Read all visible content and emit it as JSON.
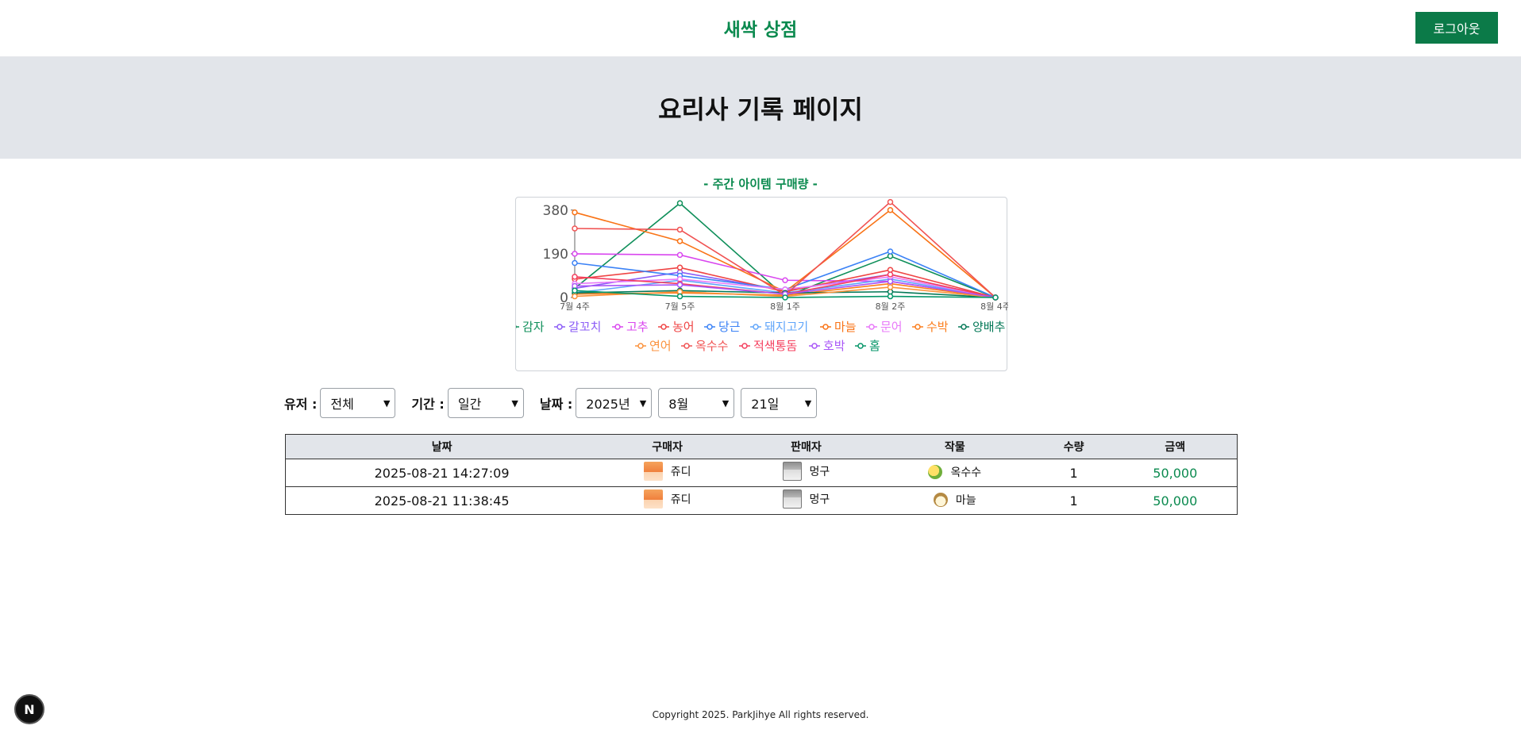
{
  "header": {
    "brand": "새싹 상점",
    "logout_label": "로그아웃"
  },
  "banner": {
    "title": "요리사 기록 페이지"
  },
  "chart": {
    "heading": "- 주간 아이템 구매량 -"
  },
  "chart_data": {
    "type": "line",
    "title": "- 주간 아이템 구매량 -",
    "xlabel": "",
    "ylabel": "",
    "categories": [
      "7월 4주",
      "7월 5주",
      "8월 1주",
      "8월 2주",
      "8월 4주"
    ],
    "yticks": [
      0,
      190,
      380
    ],
    "ylim": [
      0,
      400
    ],
    "legend_position": "bottom",
    "series": [
      {
        "name": "감자",
        "color": "#0f8f5a",
        "values": [
          40,
          410,
          5,
          180,
          0
        ]
      },
      {
        "name": "갈꼬치",
        "color": "#8b5cf6",
        "values": [
          40,
          110,
          30,
          100,
          0
        ]
      },
      {
        "name": "고추",
        "color": "#d946ef",
        "values": [
          190,
          185,
          75,
          70,
          0
        ]
      },
      {
        "name": "농어",
        "color": "#ef4444",
        "values": [
          80,
          130,
          25,
          120,
          0
        ]
      },
      {
        "name": "당근",
        "color": "#3b82f6",
        "values": [
          150,
          95,
          35,
          200,
          0
        ]
      },
      {
        "name": "돼지고기",
        "color": "#60a5fa",
        "values": [
          20,
          75,
          20,
          80,
          0
        ]
      },
      {
        "name": "마늘",
        "color": "#f97316",
        "values": [
          370,
          245,
          25,
          380,
          0
        ]
      },
      {
        "name": "문어",
        "color": "#e879f9",
        "values": [
          60,
          80,
          35,
          90,
          0
        ]
      },
      {
        "name": "수박",
        "color": "#fb7d1c",
        "values": [
          15,
          20,
          10,
          60,
          0
        ]
      },
      {
        "name": "양배추",
        "color": "#047857",
        "values": [
          20,
          30,
          20,
          25,
          0
        ]
      },
      {
        "name": "연어",
        "color": "#fb923c",
        "values": [
          5,
          25,
          5,
          45,
          0
        ]
      },
      {
        "name": "옥수수",
        "color": "#f05252",
        "values": [
          300,
          295,
          10,
          415,
          0
        ]
      },
      {
        "name": "적색통돔",
        "color": "#f43f5e",
        "values": [
          90,
          60,
          15,
          100,
          0
        ]
      },
      {
        "name": "호박",
        "color": "#a855f7",
        "values": [
          50,
          55,
          15,
          70,
          0
        ]
      },
      {
        "name": "홈",
        "color": "#059669",
        "values": [
          30,
          5,
          0,
          5,
          0
        ]
      }
    ]
  },
  "filters": {
    "user_label": "유저 :",
    "user_value": "전체",
    "period_label": "기간 :",
    "period_value": "일간",
    "date_label": "날짜 :",
    "year_value": "2025년",
    "month_value": "8월",
    "day_value": "21일"
  },
  "table": {
    "headers": [
      "날짜",
      "구매자",
      "판매자",
      "작물",
      "수량",
      "금액"
    ],
    "rows": [
      {
        "date": "2025-08-21 14:27:09",
        "buyer": "쥬디",
        "seller": "멍구",
        "crop": "옥수수",
        "qty": "1",
        "amount": "50,000"
      },
      {
        "date": "2025-08-21 11:38:45",
        "buyer": "쥬디",
        "seller": "멍구",
        "crop": "마늘",
        "qty": "1",
        "amount": "50,000"
      }
    ]
  },
  "badge": {
    "label": "N"
  },
  "footer": {
    "text": "Copyright 2025. ParkJihye All rights reserved."
  }
}
